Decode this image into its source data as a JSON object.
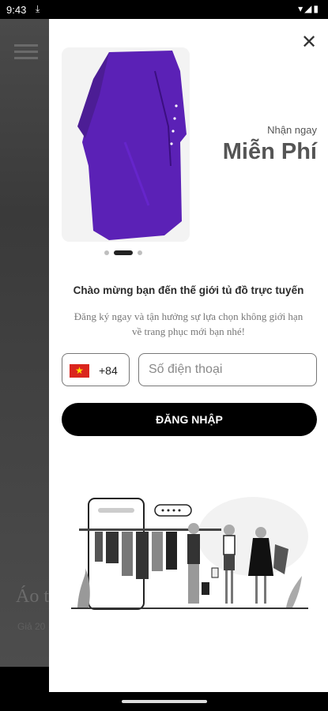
{
  "status_bar": {
    "time": "9:43",
    "download_icon": "download-icon",
    "icons": [
      "wifi-icon",
      "signal-icon",
      "battery-icon"
    ]
  },
  "background_page": {
    "title_fragment": "Áo t",
    "subtitle_fragment": "Giả 20"
  },
  "modal": {
    "close_icon": "close-icon",
    "promo": {
      "small": "Nhận ngay",
      "big": "Miễn Phí"
    },
    "carousel": {
      "total": 3,
      "active_index": 1
    },
    "welcome_text": "Chào mừng bạn đến thế giới tủ đồ trực tuyến",
    "description": "Đăng ký ngay và tận hưởng sự lựa chọn không giới  hạn về  trang phục mới bạn nhé!",
    "country": {
      "flag": "vietnam-flag-icon",
      "code": "+84"
    },
    "phone_placeholder": "Số điện thoại",
    "login_label": "ĐĂNG NHẬP"
  },
  "colors": {
    "accent": "#000000",
    "product_color": "#5b21b6",
    "promo_text": "#555555"
  }
}
